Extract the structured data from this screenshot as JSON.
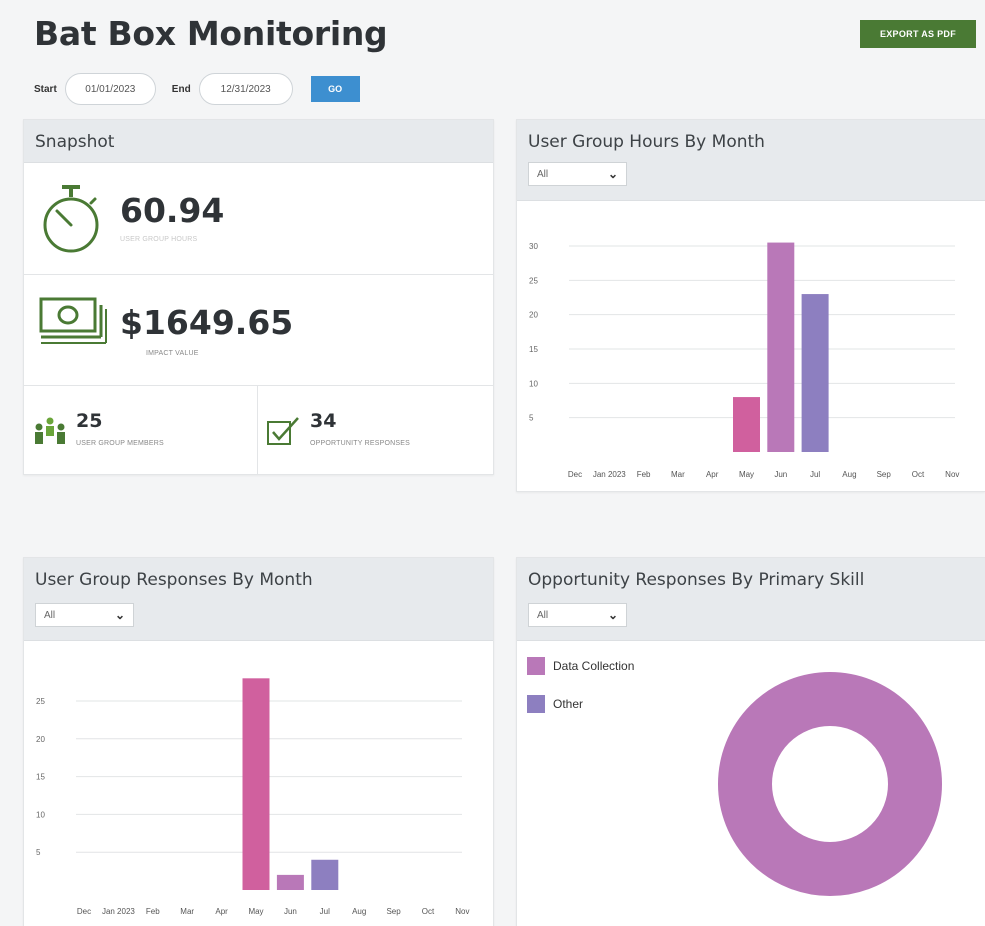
{
  "header": {
    "title": "Bat Box Monitoring",
    "export_label": "EXPORT AS PDF",
    "start_label": "Start",
    "start_value": "01/01/2023",
    "end_label": "End",
    "end_value": "12/31/2023",
    "go_label": "GO"
  },
  "snapshot": {
    "title": "Snapshot",
    "hours_value": "60.94",
    "hours_label": "USER GROUP HOURS",
    "impact_value": "$1649.65",
    "impact_label": "IMPACT VALUE",
    "members_value": "25",
    "members_label": "USER GROUP MEMBERS",
    "responses_value": "34",
    "responses_label": "OPPORTUNITY RESPONSES"
  },
  "colors": {
    "pink": "#d0609e",
    "mauve": "#b978b8",
    "purple": "#8d7fc0",
    "export_green": "#4a7a34",
    "go_blue": "#3d8fd0"
  },
  "hours_chart": {
    "title": "User Group Hours By Month",
    "filter_value": "All",
    "chart_data": {
      "type": "bar",
      "categories": [
        "Dec",
        "Jan 2023",
        "Feb",
        "Mar",
        "Apr",
        "May",
        "Jun",
        "Jul",
        "Aug",
        "Sep",
        "Oct",
        "Nov"
      ],
      "values": [
        0,
        0,
        0,
        0,
        0,
        8,
        30.5,
        23,
        0,
        0,
        0,
        0
      ],
      "bar_colors": [
        "",
        "",
        "",
        "",
        "",
        "#d0609e",
        "#b978b8",
        "#8d7fc0",
        "",
        "",
        "",
        ""
      ],
      "y_ticks": [
        5,
        10,
        15,
        20,
        25,
        30
      ],
      "ylim": [
        0,
        30
      ]
    }
  },
  "responses_chart": {
    "title": "User Group Responses By Month",
    "filter_value": "All",
    "chart_data": {
      "type": "bar",
      "categories": [
        "Dec",
        "Jan 2023",
        "Feb",
        "Mar",
        "Apr",
        "May",
        "Jun",
        "Jul",
        "Aug",
        "Sep",
        "Oct",
        "Nov"
      ],
      "values": [
        0,
        0,
        0,
        0,
        0,
        28,
        2,
        4,
        0,
        0,
        0,
        0
      ],
      "bar_colors": [
        "",
        "",
        "",
        "",
        "",
        "#d0609e",
        "#b978b8",
        "#8d7fc0",
        "",
        "",
        "",
        ""
      ],
      "y_ticks": [
        5,
        10,
        15,
        20,
        25
      ],
      "ylim": [
        0,
        25
      ]
    }
  },
  "skill_chart": {
    "title": "Opportunity Responses By Primary Skill",
    "filter_value": "All",
    "chart_data": {
      "type": "pie",
      "legend": [
        "Data Collection",
        "Other"
      ],
      "values": [
        34,
        0
      ],
      "colors": [
        "#b978b8",
        "#8d7fc0"
      ]
    }
  }
}
